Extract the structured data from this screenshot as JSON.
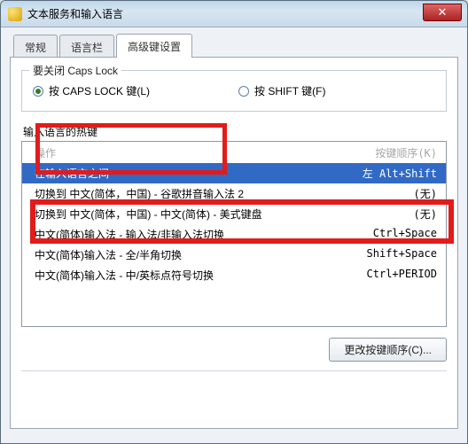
{
  "window": {
    "title": "文本服务和输入语言",
    "close_glyph": "✕"
  },
  "tabs": {
    "general": "常规",
    "langbar": "语言栏",
    "advanced": "高级键设置"
  },
  "capslock": {
    "legend": "要关闭 Caps Lock",
    "opt_caps": "按 CAPS LOCK 键(L)",
    "opt_shift": "按 SHIFT 键(F)"
  },
  "hotkeys_caption": "输入语言的热键",
  "list": {
    "header_l": "操作",
    "header_r": "按键顺序(K)",
    "rows": [
      {
        "l": "在输入语言之间",
        "r": "左 Alt+Shift"
      },
      {
        "l": "切换到 中文(简体，中国) - 谷歌拼音输入法 2",
        "r": "(无)"
      },
      {
        "l": "切换到 中文(简体，中国) - 中文(简体) - 美式键盘",
        "r": "(无)"
      },
      {
        "l": "中文(简体)输入法 - 输入法/非输入法切换",
        "r": "Ctrl+Space"
      },
      {
        "l": "中文(简体)输入法 - 全/半角切换",
        "r": "Shift+Space"
      },
      {
        "l": "中文(简体)输入法 - 中/英标点符号切换",
        "r": "Ctrl+PERIOD"
      }
    ]
  },
  "buttons": {
    "change_seq": "更改按键顺序(C)..."
  }
}
